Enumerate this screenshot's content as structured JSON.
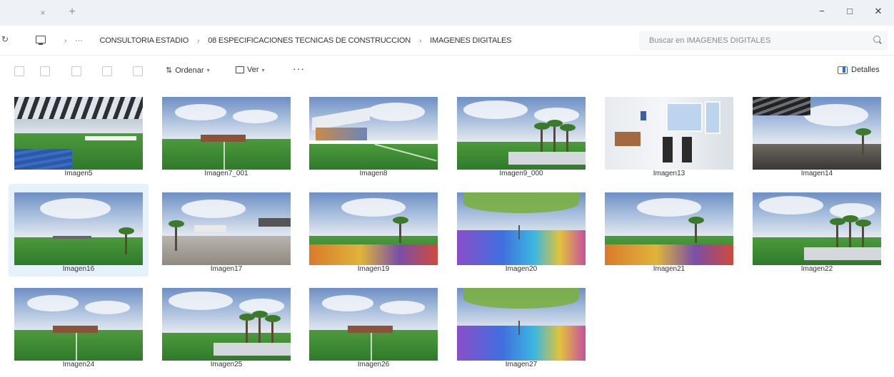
{
  "window": {
    "tab_close": "×",
    "tab_new": "+",
    "minimize": "−",
    "maximize": "□",
    "close": "✕"
  },
  "address": {
    "refresh": "↻",
    "ellipsis": "···",
    "crumbs": [
      "CONSULTORIA ESTADIO",
      "08 ESPECIFICACIONES TECNICAS DE CONSTRUCCION",
      "IMAGENES DIGITALES"
    ],
    "search_placeholder": "Buscar en IMAGENES DIGITALES"
  },
  "commands": {
    "sort_label": "Ordenar",
    "view_label": "Ver",
    "more": "···",
    "details_label": "Detalles"
  },
  "files": [
    {
      "name": "Imagen5",
      "scene": "stadium-stands",
      "selected": false
    },
    {
      "name": "Imagen7_001",
      "scene": "field-stand",
      "selected": false
    },
    {
      "name": "Imagen8",
      "scene": "field-roof",
      "selected": false
    },
    {
      "name": "Imagen9_000",
      "scene": "field-palms",
      "selected": false
    },
    {
      "name": "Imagen13",
      "scene": "interior",
      "selected": false
    },
    {
      "name": "Imagen14",
      "scene": "terrace",
      "selected": false
    },
    {
      "name": "Imagen16",
      "scene": "field-wide",
      "selected": true
    },
    {
      "name": "Imagen17",
      "scene": "plaza",
      "selected": false
    },
    {
      "name": "Imagen19",
      "scene": "playground",
      "selected": false
    },
    {
      "name": "Imagen20",
      "scene": "court",
      "selected": false
    },
    {
      "name": "Imagen21",
      "scene": "playground",
      "selected": false
    },
    {
      "name": "Imagen22",
      "scene": "field-palms",
      "selected": false
    },
    {
      "name": "Imagen24",
      "scene": "field-stand",
      "selected": false
    },
    {
      "name": "Imagen25",
      "scene": "field-palms",
      "selected": false
    },
    {
      "name": "Imagen26",
      "scene": "field-stand",
      "selected": false
    },
    {
      "name": "Imagen27",
      "scene": "court",
      "selected": false
    }
  ]
}
